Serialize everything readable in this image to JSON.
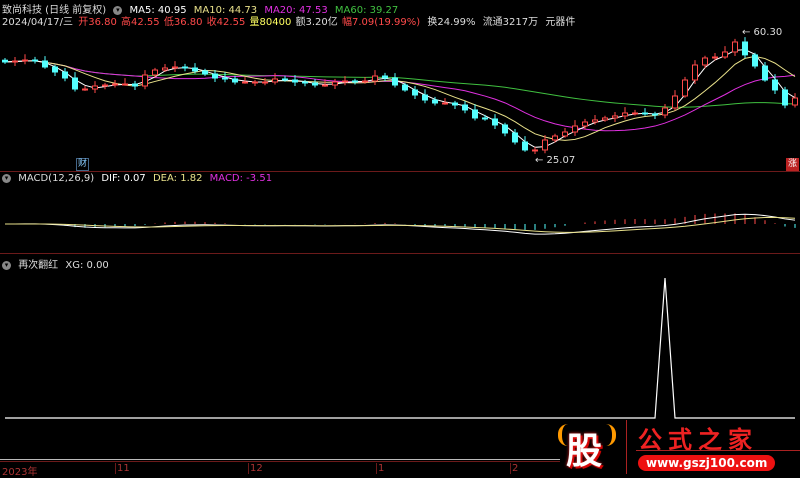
{
  "header": {
    "stock_name": "致尚科技 (日线 前复权)",
    "ma5": "MA5: 40.95",
    "ma10": "MA10: 44.73",
    "ma20": "MA20: 47.53",
    "ma60": "MA60: 39.27",
    "date": "2024/04/17/三",
    "open": "开36.80",
    "high": "高42.55",
    "low": "低36.80",
    "close": "收42.55",
    "volume": "量80400",
    "amount": "额3.20亿",
    "change": "幅7.09(19.99%)",
    "turnover": "换24.99%",
    "float": "流通3217万",
    "sector": "元器件"
  },
  "main": {
    "high_label": "60.30",
    "low_label": "25.07",
    "fin_tag": "财",
    "rise_tag": "涨"
  },
  "macd_panel": {
    "title": "MACD(12,26,9)",
    "dif": "DIF: 0.07",
    "dea": "DEA: 1.82",
    "macd": "MACD: -3.51"
  },
  "xg_panel": {
    "title": "再次翻红",
    "xg": "XG: 0.00"
  },
  "axis": {
    "labels": [
      "2023年",
      "11",
      "12",
      "1",
      "2"
    ]
  },
  "watermark": {
    "logo_char": "股",
    "site_name": "公式之家",
    "url": "www.gszj100.com"
  },
  "colors": {
    "up": "#ff4a4a",
    "down": "#54ffff",
    "ma5": "#ffffff",
    "ma10": "#e8e08a",
    "ma20": "#e030e0",
    "ma60": "#40c040",
    "macd_label": "#e030e0"
  },
  "chart_data": {
    "type": "candlestick",
    "price_range": [
      25.07,
      60.3
    ],
    "closes": [
      52.04,
      52.32,
      52.59,
      52.32,
      50.67,
      49.29,
      47.64,
      44.61,
      44.61,
      45.44,
      45.71,
      45.99,
      45.99,
      45.44,
      48.47,
      49.84,
      50.39,
      50.67,
      50.39,
      49.57,
      48.74,
      47.64,
      47.37,
      46.54,
      46.54,
      46.54,
      46.54,
      47.37,
      47.09,
      46.54,
      46.27,
      45.71,
      45.71,
      46.54,
      46.82,
      46.54,
      46.82,
      48.19,
      47.64,
      45.71,
      44.34,
      42.96,
      41.58,
      40.76,
      40.76,
      40.21,
      38.84,
      36.64,
      36.36,
      34.71,
      32.51,
      30.03,
      27.83,
      27.83,
      30.58,
      31.68,
      32.78,
      34.43,
      35.53,
      36.09,
      36.64,
      37.19,
      38.01,
      38.01,
      37.74,
      37.46,
      39.39,
      42.69,
      47.09,
      51.22,
      53.15,
      53.42,
      54.8,
      57.55,
      54.0,
      50.94,
      47.09,
      44.34,
      40.21,
      42.14
    ],
    "xg_signal_index": 66
  }
}
